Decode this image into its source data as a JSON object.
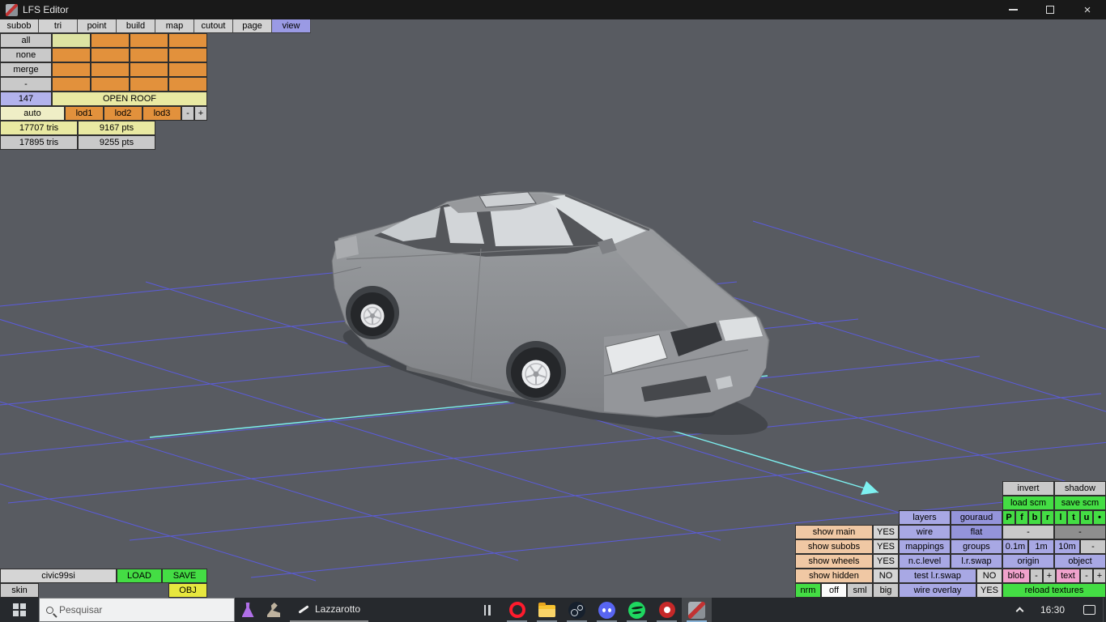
{
  "titlebar": {
    "title": "LFS Editor",
    "close_glyph": "×"
  },
  "menu": {
    "tabs": [
      "subob",
      "tri",
      "point",
      "build",
      "map",
      "cutout",
      "page",
      "view"
    ],
    "active_tab": "view"
  },
  "subob_panel": {
    "select_all": "all",
    "select_none": "none",
    "merge": "merge",
    "collapse": "-",
    "page_count": "147",
    "subobject_name": "OPEN ROOF",
    "lod_auto": "auto",
    "lod1": "lod1",
    "lod2": "lod2",
    "lod3": "lod3",
    "lod_minus": "-",
    "lod_plus": "+",
    "current_tris": "17707 tris",
    "current_pts": "9167 pts",
    "total_tris": "17895 tris",
    "total_pts": "9255 pts",
    "grid": {
      "rows": 4,
      "cols": 4,
      "selected_row": 0,
      "selected_col": 0
    }
  },
  "file_panel": {
    "model_name": "civic99si",
    "load": "LOAD",
    "save": "SAVE",
    "skin": "skin",
    "obj": "OBJ"
  },
  "view_panel": {
    "invert": "invert",
    "shadow": "shadow",
    "load_scm": "load scm",
    "save_scm": "save scm",
    "layers": "layers",
    "gouraud": "gouraud",
    "page_toggles": [
      "P",
      "f",
      "b",
      "r",
      "l",
      "t",
      "u",
      "•"
    ],
    "show_main": "show main",
    "show_main_val": "YES",
    "wire": "wire",
    "flat": "flat",
    "flat_dash1": "-",
    "flat_dash2": "-",
    "show_subobs": "show subobs",
    "show_subobs_val": "YES",
    "mappings": "mappings",
    "groups": "groups",
    "grid_01m": "0.1m",
    "grid_1m": "1m",
    "grid_10m": "10m",
    "grid_dash": "-",
    "show_wheels": "show wheels",
    "show_wheels_val": "YES",
    "nc_level": "n.c.level",
    "lr_swap": "l.r.swap",
    "origin": "origin",
    "object": "object",
    "show_hidden": "show hidden",
    "show_hidden_val": "NO",
    "test_lr_swap": "test l.r.swap",
    "test_lr_swap_val": "NO",
    "blob": "blob",
    "blob_minus": "-",
    "blob_plus": "+",
    "text": "text",
    "text_minus": "-",
    "text_plus": "+",
    "nrm": "nrm",
    "nrm_off": "off",
    "nrm_sml": "sml",
    "nrm_big": "big",
    "wire_overlay": "wire overlay",
    "wire_overlay_val": "YES",
    "reload_textures": "reload textures"
  },
  "taskbar": {
    "search_placeholder": "Pesquisar",
    "window_label": "Lazzarotto",
    "time": "16:30"
  },
  "colors": {
    "viewport_bg": "#585b61",
    "grid_line": "#5c5cf2",
    "axis_line": "#7df0f0",
    "car_body": "#8f9194",
    "panel_orange": "#e2913c",
    "panel_lavender": "#a8a8e4",
    "panel_green": "#44dd44",
    "panel_yellow": "#e9e9a2",
    "panel_peach": "#f0c8a4",
    "panel_pink": "#f0a2cc",
    "selection_blue": "#9a9ae4"
  }
}
